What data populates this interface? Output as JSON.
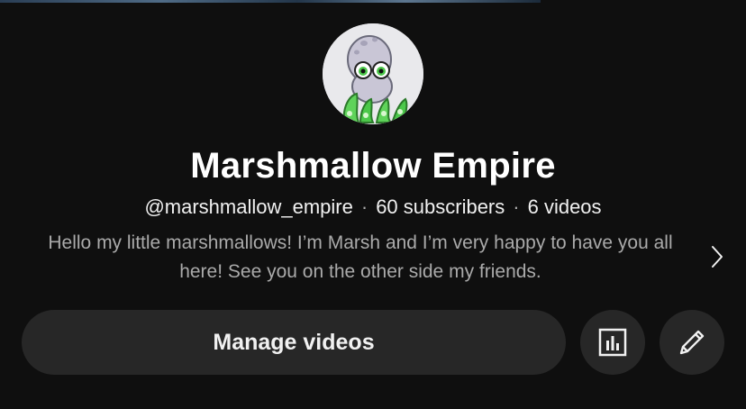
{
  "channel": {
    "name": "Marshmallow Empire",
    "handle": "@marshmallow_empire",
    "subscribers": "60 subscribers",
    "videos": "6 videos",
    "separator": "·",
    "description": "Hello my little marshmallows! I’m Marsh and I’m very happy to have you all here! See you on the other side my friends."
  },
  "actions": {
    "manage_label": "Manage videos",
    "analytics_icon": "bar-chart-icon",
    "edit_icon": "pencil-icon",
    "more_icon": "chevron-right-icon"
  },
  "colors": {
    "background": "#0f0f0f",
    "button_bg": "#272727",
    "primary_text": "#f1f1f1",
    "secondary_text": "#aaaaaa",
    "avatar_accent": "#4cc84a"
  }
}
